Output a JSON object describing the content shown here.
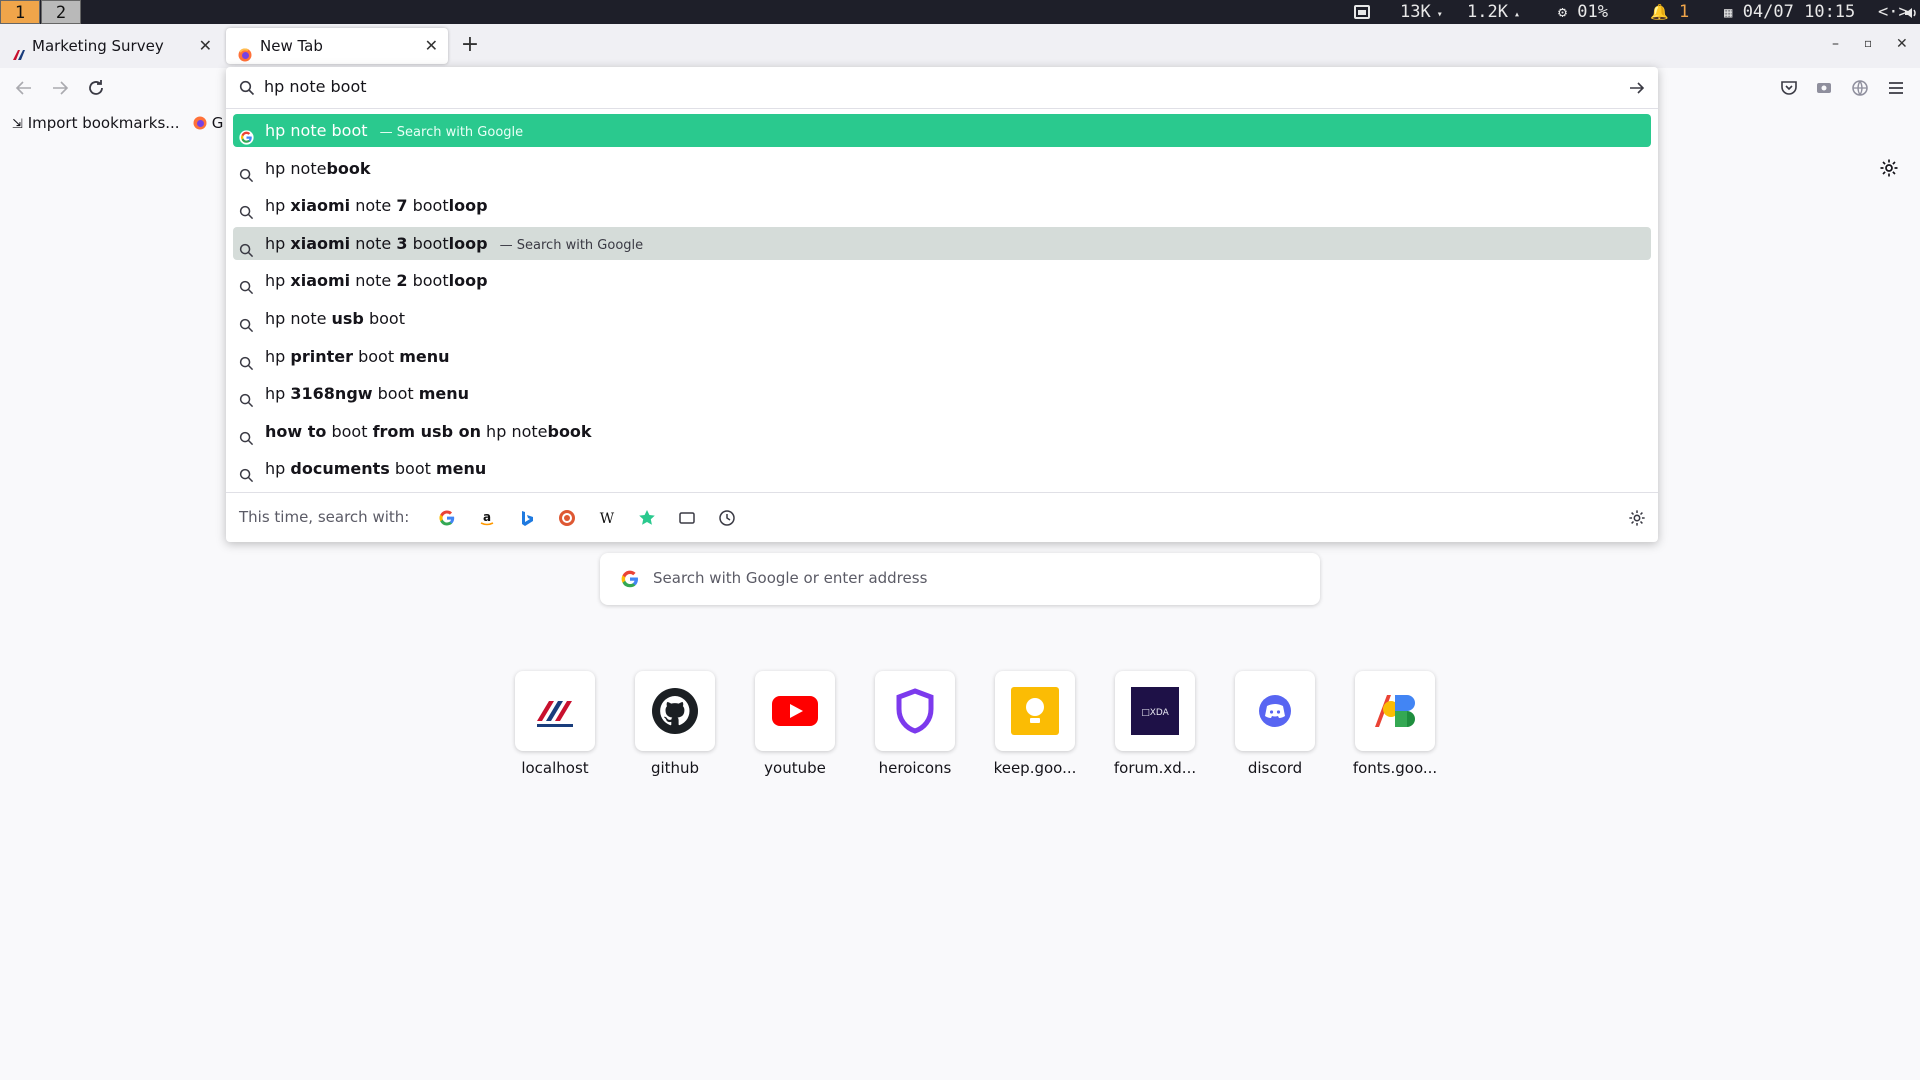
{
  "system_bar": {
    "workspaces": [
      "1",
      "2"
    ],
    "download_speed": "13K",
    "upload_speed": "1.2K",
    "cpu": "01%",
    "notifications": "1",
    "datetime": "04/07 10:15"
  },
  "tabs": [
    {
      "title": "Marketing Survey",
      "active": false
    },
    {
      "title": "New Tab",
      "active": true
    }
  ],
  "bookmarks": {
    "import_label": "Import bookmarks...",
    "item2_label": "G"
  },
  "urlbar": {
    "value": "hp note boot",
    "suggestions": [
      {
        "parts": [
          {
            "t": "hp note boot",
            "b": false
          }
        ],
        "action": "— Search with Google",
        "icon": "google-icon",
        "state": "selected"
      },
      {
        "parts": [
          {
            "t": "hp note",
            "b": false
          },
          {
            "t": "book",
            "b": true
          }
        ],
        "action": "",
        "icon": "search-icon",
        "state": ""
      },
      {
        "parts": [
          {
            "t": "hp ",
            "b": false
          },
          {
            "t": "xiaomi",
            "b": true
          },
          {
            "t": " note ",
            "b": false
          },
          {
            "t": "7",
            "b": true
          },
          {
            "t": " boot",
            "b": false
          },
          {
            "t": "loop",
            "b": true
          }
        ],
        "action": "",
        "icon": "search-icon",
        "state": ""
      },
      {
        "parts": [
          {
            "t": "hp ",
            "b": false
          },
          {
            "t": "xiaomi",
            "b": true
          },
          {
            "t": " note ",
            "b": false
          },
          {
            "t": "3",
            "b": true
          },
          {
            "t": " boot",
            "b": false
          },
          {
            "t": "loop",
            "b": true
          }
        ],
        "action": "— Search with Google",
        "icon": "search-icon",
        "state": "hover"
      },
      {
        "parts": [
          {
            "t": "hp ",
            "b": false
          },
          {
            "t": "xiaomi",
            "b": true
          },
          {
            "t": " note ",
            "b": false
          },
          {
            "t": "2",
            "b": true
          },
          {
            "t": " boot",
            "b": false
          },
          {
            "t": "loop",
            "b": true
          }
        ],
        "action": "",
        "icon": "search-icon",
        "state": ""
      },
      {
        "parts": [
          {
            "t": "hp note ",
            "b": false
          },
          {
            "t": "usb",
            "b": true
          },
          {
            "t": " boot",
            "b": false
          }
        ],
        "action": "",
        "icon": "search-icon",
        "state": ""
      },
      {
        "parts": [
          {
            "t": "hp ",
            "b": false
          },
          {
            "t": "printer",
            "b": true
          },
          {
            "t": " boot ",
            "b": false
          },
          {
            "t": "menu",
            "b": true
          }
        ],
        "action": "",
        "icon": "search-icon",
        "state": ""
      },
      {
        "parts": [
          {
            "t": "hp ",
            "b": false
          },
          {
            "t": "3168ngw",
            "b": true
          },
          {
            "t": " boot ",
            "b": false
          },
          {
            "t": "menu",
            "b": true
          }
        ],
        "action": "",
        "icon": "search-icon",
        "state": ""
      },
      {
        "parts": [
          {
            "t": "how to",
            "b": true
          },
          {
            "t": " boot ",
            "b": false
          },
          {
            "t": "from usb on",
            "b": true
          },
          {
            "t": " hp note",
            "b": false
          },
          {
            "t": "book",
            "b": true
          }
        ],
        "action": "",
        "icon": "search-icon",
        "state": ""
      },
      {
        "parts": [
          {
            "t": "hp ",
            "b": false
          },
          {
            "t": "documents",
            "b": true
          },
          {
            "t": " boot ",
            "b": false
          },
          {
            "t": "menu",
            "b": true
          }
        ],
        "action": "",
        "icon": "search-icon",
        "state": ""
      }
    ],
    "one_off_label": "This time, search with:",
    "one_off_engines": [
      "google",
      "amazon",
      "bing",
      "duckduckgo",
      "wikipedia",
      "bookmarks",
      "tabs",
      "history"
    ]
  },
  "newtab": {
    "search_placeholder": "Search with Google or enter address",
    "top_sites": [
      {
        "label": "localhost",
        "icon": "localhost-logo"
      },
      {
        "label": "github",
        "icon": "github-logo"
      },
      {
        "label": "youtube",
        "icon": "youtube-logo"
      },
      {
        "label": "heroicons",
        "icon": "shield-logo"
      },
      {
        "label": "keep.goo...",
        "icon": "keep-logo"
      },
      {
        "label": "forum.xd...",
        "icon": "xda-logo",
        "logo_text": "□XDA"
      },
      {
        "label": "discord",
        "icon": "discord-logo"
      },
      {
        "label": "fonts.goo...",
        "icon": "google-fonts-logo"
      }
    ]
  },
  "colors": {
    "selected_row": "#2ac98e",
    "hover_row": "#d5dcd9",
    "workspace_active": "#f0a54a"
  }
}
